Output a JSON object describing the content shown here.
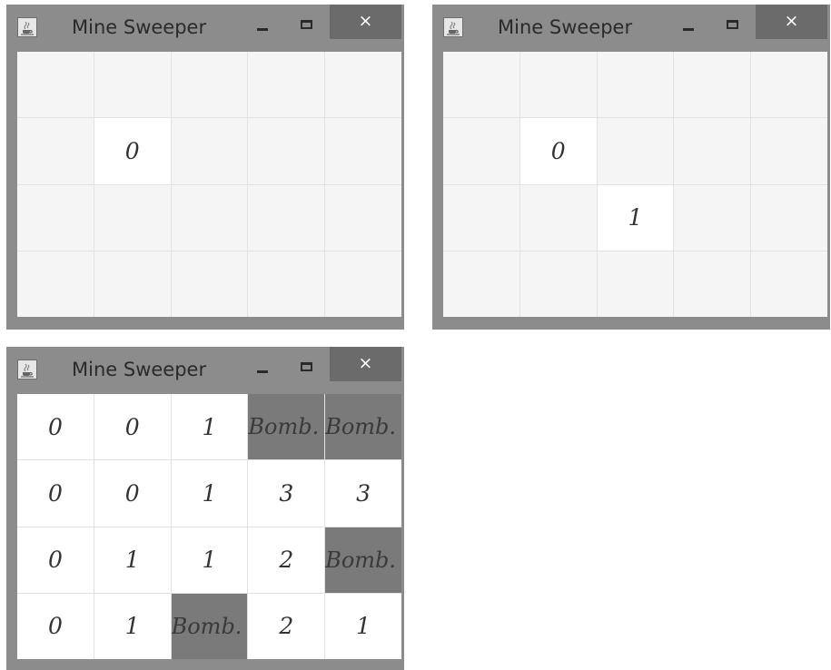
{
  "windows": [
    {
      "title": "Mine Sweeper",
      "close_glyph": "×",
      "icon": "java-cup-icon",
      "cells": [
        [
          "",
          "",
          "",
          "",
          ""
        ],
        [
          "",
          "0",
          "",
          "",
          ""
        ],
        [
          "",
          "",
          "",
          "",
          ""
        ],
        [
          "",
          "",
          "",
          "",
          ""
        ]
      ]
    },
    {
      "title": "Mine Sweeper",
      "close_glyph": "×",
      "icon": "java-cup-icon",
      "cells": [
        [
          "",
          "",
          "",
          "",
          ""
        ],
        [
          "",
          "0",
          "",
          "",
          ""
        ],
        [
          "",
          "",
          "1",
          "",
          ""
        ],
        [
          "",
          "",
          "",
          "",
          ""
        ]
      ]
    },
    {
      "title": "Mine Sweeper",
      "close_glyph": "×",
      "icon": "java-cup-icon",
      "cells": [
        [
          "0",
          "0",
          "1",
          "Bomb.",
          "Bomb."
        ],
        [
          "0",
          "0",
          "1",
          "3",
          "3"
        ],
        [
          "0",
          "1",
          "1",
          "2",
          "Bomb."
        ],
        [
          "0",
          "1",
          "Bomb.",
          "2",
          "1"
        ]
      ]
    }
  ],
  "colors": {
    "frame": "#8c8c8c",
    "close_button": "#6b6b6b",
    "unrevealed_cell": "#f5f5f5",
    "revealed_cell": "#ffffff",
    "bomb_cell": "#7a7a7a"
  }
}
